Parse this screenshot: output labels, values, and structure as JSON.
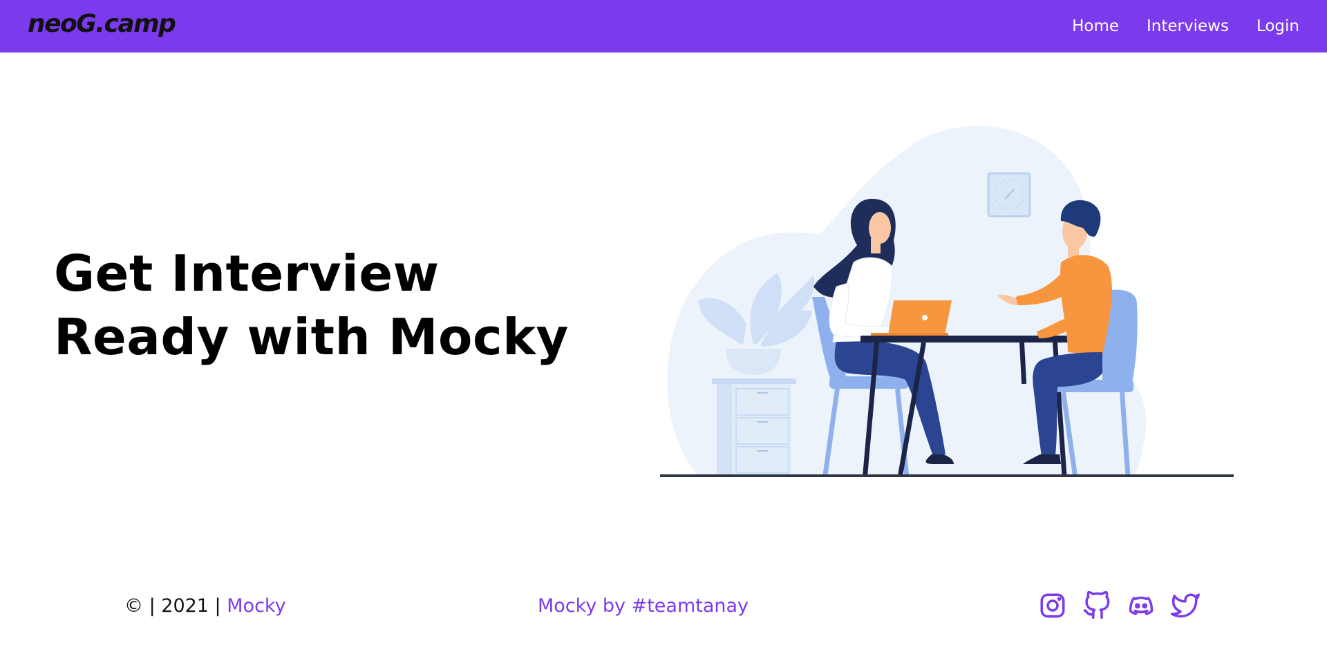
{
  "navbar": {
    "logo": "neoG.camp",
    "links": [
      {
        "label": "Home"
      },
      {
        "label": "Interviews"
      },
      {
        "label": "Login"
      }
    ]
  },
  "hero": {
    "title_line1": "Get Interview",
    "title_line2": "Ready with Mocky",
    "illustration": "two-people-interview-at-table-illustration"
  },
  "footer": {
    "copyright_prefix": "© | 2021 | ",
    "copyright_link": "Mocky",
    "credit": "Mocky by #teamtanay",
    "social_icons": [
      "instagram-icon",
      "github-icon",
      "discord-icon",
      "twitter-icon"
    ]
  },
  "colors": {
    "brand": "#7c3aed",
    "text": "#000000",
    "background": "#ffffff"
  }
}
